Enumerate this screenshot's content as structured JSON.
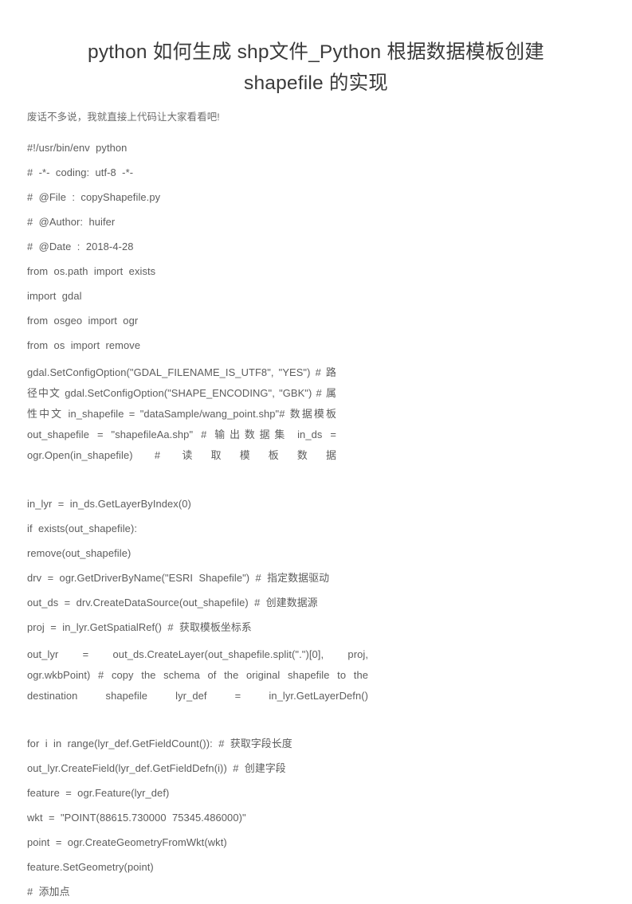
{
  "document": {
    "title": "python 如何生成 shp文件_Python 根据数据模板创建 shapefile 的实现",
    "intro": "废话不多说，我就直接上代码让大家看看吧!",
    "code_lines_top": [
      "#!/usr/bin/env  python",
      "#  -*-  coding:  utf-8  -*-",
      "#  @File  :  copyShapefile.py",
      "#  @Author:  huifer",
      "#  @Date  :  2018-4-28",
      "from  os.path  import  exists",
      "import  gdal",
      "from  osgeo  import  ogr",
      "from  os  import  remove"
    ],
    "code_paragraph_1": "gdal.SetConfigOption(\"GDAL_FILENAME_IS_UTF8\",  \"YES\")  #  路径中文 gdal.SetConfigOption(\"SHAPE_ENCODING\",  \"GBK\")  #  属性中文 in_shapefile  =  \"dataSample/wang_point.shp\"#  数据模板 out_shapefile  =  \"shapefileAa.shp\"  #  输出数据集 in_ds  =  ogr.Open(in_shapefile)  #  读取模板数据",
    "code_lines_mid": [
      "in_lyr  =  in_ds.GetLayerByIndex(0)",
      "if  exists(out_shapefile):",
      "remove(out_shapefile)",
      "drv  =  ogr.GetDriverByName(\"ESRI  Shapefile\")  #  指定数据驱动",
      "out_ds  =  drv.CreateDataSource(out_shapefile)  #  创建数据源",
      "proj  =  in_lyr.GetSpatialRef()  #  获取模板坐标系"
    ],
    "code_paragraph_2": "out_lyr  =  out_ds.CreateLayer(out_shapefile.split(\".\")[0],  proj,  ogr.wkbPoint)  #  copy  the  schema  of  the  original  shapefile  to  the  destination  shapefile lyr_def  =  in_lyr.GetLayerDefn()",
    "code_lines_bottom": [
      "for  i  in  range(lyr_def.GetFieldCount()):  #  获取字段长度",
      "out_lyr.CreateField(lyr_def.GetFieldDefn(i))  #  创建字段",
      "feature  =  ogr.Feature(lyr_def)",
      "wkt  =  \"POINT(88615.730000  75345.486000)\"",
      "point  =  ogr.CreateGeometryFromWkt(wkt)",
      "feature.SetGeometry(point)",
      "#  添加点"
    ],
    "colors": {
      "background": "#ffffff",
      "title_text": "#3a3a3a",
      "body_text": "#5c5c5c",
      "intro_text": "#6b6b6b"
    }
  }
}
